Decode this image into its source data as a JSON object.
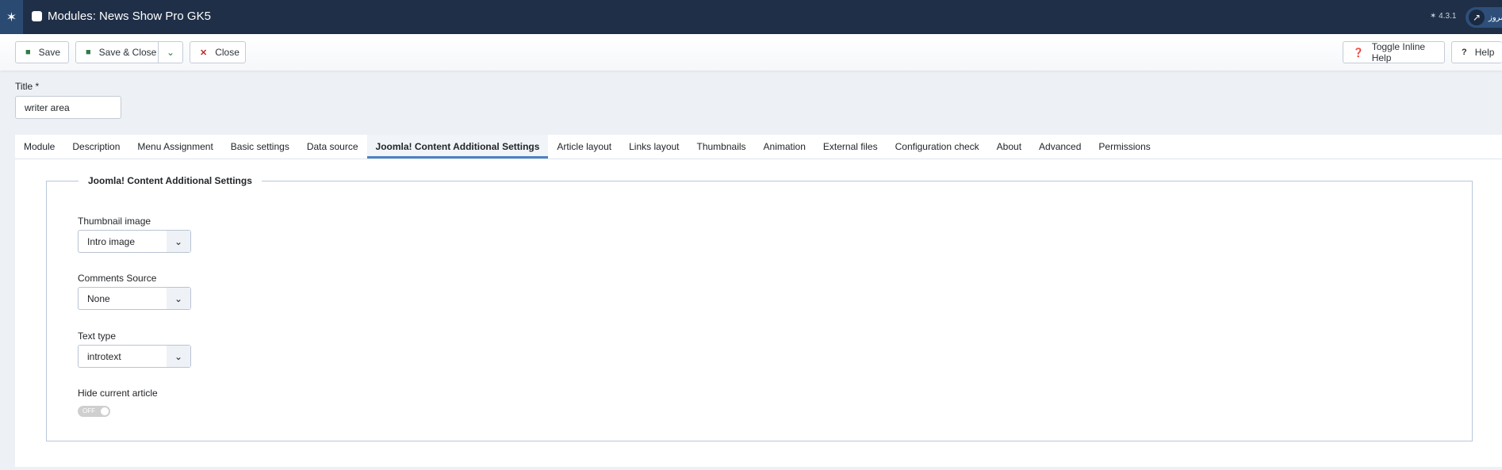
{
  "header": {
    "title": "Modules: News Show Pro GK5",
    "version": "4.3.1",
    "site_link_label": "امروز"
  },
  "toolbar": {
    "save": "Save",
    "save_close": "Save & Close",
    "close": "Close",
    "toggle_help": "Toggle Inline Help",
    "help": "Help"
  },
  "title_field": {
    "label": "Title *",
    "value": "writer area"
  },
  "tabs": [
    "Module",
    "Description",
    "Menu Assignment",
    "Basic settings",
    "Data source",
    "Joomla! Content Additional Settings",
    "Article layout",
    "Links layout",
    "Thumbnails",
    "Animation",
    "External files",
    "Configuration check",
    "About",
    "Advanced",
    "Permissions"
  ],
  "active_tab": "Joomla! Content Additional Settings",
  "fieldset": {
    "legend": "Joomla! Content Additional Settings",
    "thumbnail_label": "Thumbnail image",
    "thumbnail_value": "Intro image",
    "comments_label": "Comments Source",
    "comments_value": "None",
    "texttype_label": "Text type",
    "texttype_value": "introtext",
    "hide_label": "Hide current article",
    "hide_value": "OFF"
  }
}
